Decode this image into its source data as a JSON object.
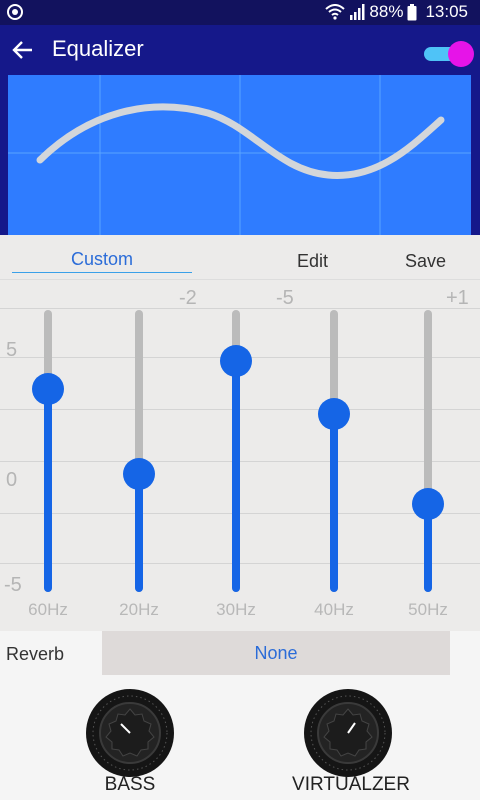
{
  "status_bar": {
    "battery": "88%",
    "time": "13:05",
    "icons": [
      "app-notification-icon",
      "wifi-icon",
      "signal-icon",
      "battery-icon"
    ]
  },
  "app_bar": {
    "title": "Equalizer",
    "enabled": true,
    "accent": "#e614e8"
  },
  "presets": {
    "selected": "Custom",
    "edit_label": "Edit",
    "save_label": "Save"
  },
  "eq": {
    "scale_labels": [
      "5",
      "0",
      "-5"
    ],
    "bands": [
      {
        "freq": "60Hz",
        "level": 0.75,
        "value_label": ""
      },
      {
        "freq": "20Hz",
        "level": 0.41,
        "value_label": "-2"
      },
      {
        "freq": "30Hz",
        "level": 0.86,
        "value_label": "-5"
      },
      {
        "freq": "40Hz",
        "level": 0.65,
        "value_label": ""
      },
      {
        "freq": "50Hz",
        "level": 0.29,
        "value_label": "+1"
      }
    ]
  },
  "reverb": {
    "label": "Reverb",
    "value": "None"
  },
  "knobs": [
    {
      "label": "BASS"
    },
    {
      "label": "VIRTUALZER"
    }
  ],
  "colors": {
    "primary": "#1565e6",
    "graph_bg": "#2f7cff",
    "app_bar": "#15188a"
  }
}
